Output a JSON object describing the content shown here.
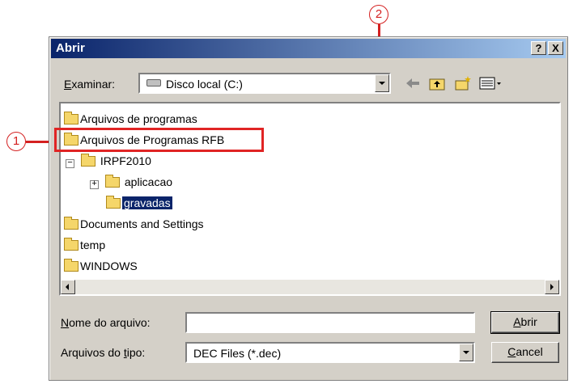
{
  "markers": {
    "one": "1",
    "two": "2"
  },
  "dialog": {
    "title": "Abrir",
    "help_button": "?",
    "close_button": "X",
    "look_in": {
      "label_accel": "E",
      "label_rest": "xaminar:",
      "value": "Disco local (C:)"
    },
    "tree": [
      {
        "label": "Arquivos de programas"
      },
      {
        "label": "Arquivos de Programas RFB"
      },
      {
        "label": "IRPF2010",
        "expander": "−"
      },
      {
        "label": "aplicacao",
        "expander": "+"
      },
      {
        "label": "gravadas",
        "selected": true
      },
      {
        "label": "Documents and Settings"
      },
      {
        "label": "temp"
      },
      {
        "label": "WINDOWS"
      }
    ],
    "filename": {
      "label_accel": "N",
      "label_rest": "ome do arquivo:",
      "value": ""
    },
    "filetype": {
      "label_pre": "Arquivos do ",
      "label_accel": "t",
      "label_post": "ipo:",
      "value": "DEC Files (*.dec)"
    },
    "open_button": {
      "accel": "A",
      "rest": "brir"
    },
    "cancel_button": {
      "accel": "C",
      "rest": "ancel"
    }
  },
  "colors": {
    "accent": "#0a246a",
    "annotation": "#d42020",
    "folder": "#f5d66a"
  }
}
